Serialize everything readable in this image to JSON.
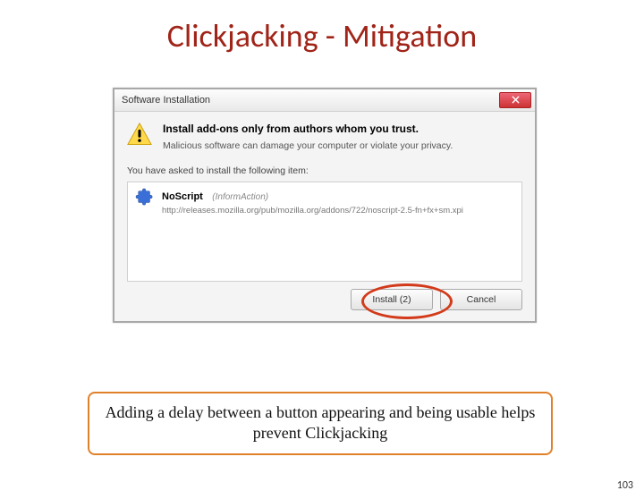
{
  "title": "Clickjacking - Mitigation",
  "dialog": {
    "window_title": "Software Installation",
    "warn_title": "Install add-ons only from authors whom you trust.",
    "warn_sub": "Malicious software can damage your computer or violate your privacy.",
    "asked": "You have asked to install the following item:",
    "item": {
      "name": "NoScript",
      "author": "(InformAction)",
      "url": "http://releases.mozilla.org/pub/mozilla.org/addons/722/noscript-2.5-fn+fx+sm.xpi"
    },
    "install_label": "Install (2)",
    "cancel_label": "Cancel"
  },
  "caption": "Adding a delay between a button appearing and being usable helps prevent Clickjacking",
  "page_number": "103"
}
